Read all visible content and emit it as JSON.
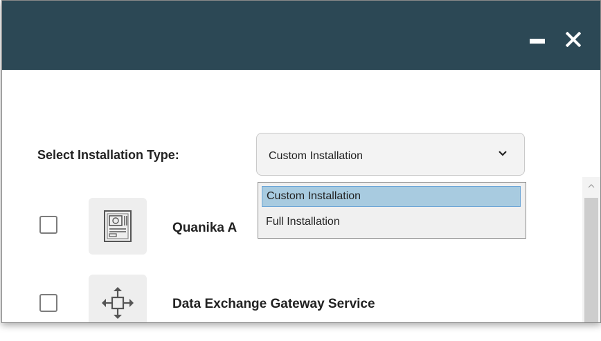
{
  "window": {
    "controls": {
      "minimize_icon": "minimize-icon",
      "close_icon": "close-icon"
    }
  },
  "installation_type": {
    "label": "Select Installation Type:",
    "selected": "Custom Installation",
    "options": [
      "Custom Installation",
      "Full Installation"
    ]
  },
  "items": [
    {
      "label": "Quanika A",
      "icon": "server-icon",
      "checked": false
    },
    {
      "label": "Data Exchange Gateway Service",
      "icon": "gateway-arrows-icon",
      "checked": false
    }
  ],
  "colors": {
    "titlebar": "#2c4855",
    "selected_option": "#a8cbe0"
  }
}
